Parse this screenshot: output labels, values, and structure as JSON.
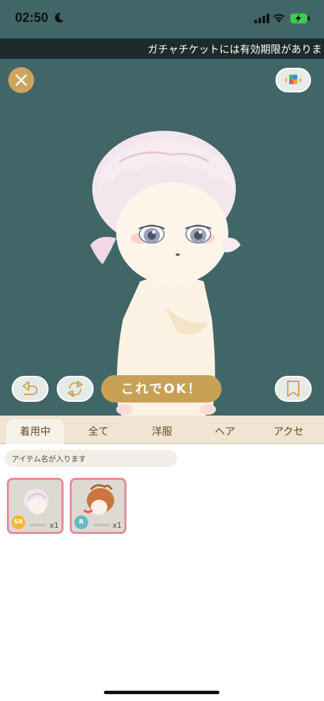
{
  "status": {
    "time": "02:50"
  },
  "ticker": {
    "text": "ガチャチケットには有効期限がありま"
  },
  "actions": {
    "ok_label": "これでOK！"
  },
  "tabs": [
    {
      "label": "着用中",
      "active": true
    },
    {
      "label": "全て",
      "active": false
    },
    {
      "label": "洋服",
      "active": false
    },
    {
      "label": "ヘア",
      "active": false
    },
    {
      "label": "アクセ",
      "active": false
    }
  ],
  "search": {
    "placeholder": "アイテム名が入ります"
  },
  "items": [
    {
      "rarity": "SR",
      "rarity_color": "#f2b733",
      "quantity": "x1",
      "hair_color": "#f1e6ee"
    },
    {
      "rarity": "R",
      "rarity_color": "#69b8c0",
      "quantity": "x1",
      "hair_color": "#c9773e"
    }
  ],
  "colors": {
    "stage_bg": "#416668",
    "accent_gold": "#c9a155",
    "tab_bar": "#f0e4d2",
    "card_border": "#e68b9a"
  }
}
